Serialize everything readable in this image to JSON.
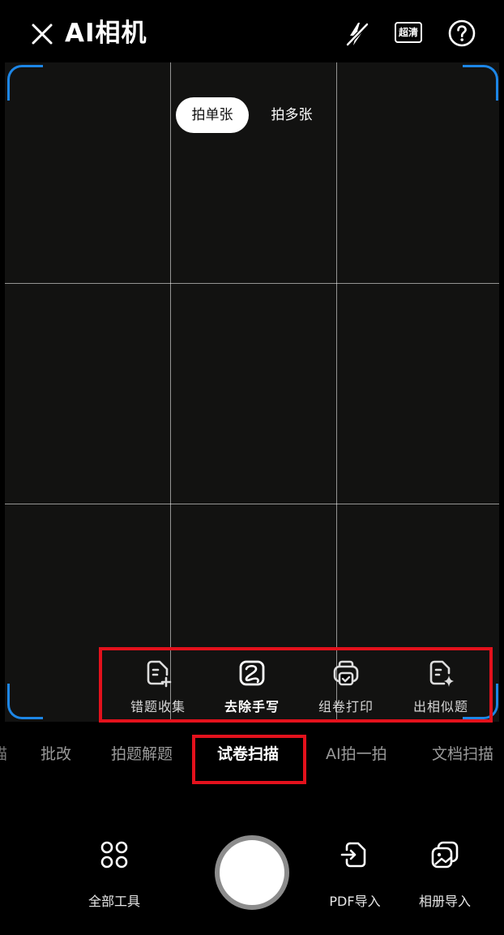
{
  "header": {
    "title": "AI相机",
    "hd_label": "超清",
    "icons": [
      "close-icon",
      "flash-off-icon",
      "help-icon"
    ]
  },
  "shot_mode": {
    "single_label": "拍单张",
    "multi_label": "拍多张",
    "selected": "拍单张"
  },
  "tools": [
    {
      "label": "错题收集",
      "icon": "doc-plus-icon"
    },
    {
      "label": "去除手写",
      "icon": "erase-handwriting-icon"
    },
    {
      "label": "组卷打印",
      "icon": "print-icon"
    },
    {
      "label": "出相似题",
      "icon": "doc-sparkle-icon"
    }
  ],
  "modes": {
    "partial": "描",
    "items": [
      "批改",
      "拍题解题",
      "试卷扫描",
      "AI拍一拍",
      "文档扫描"
    ],
    "selected": "试卷扫描"
  },
  "bottom": {
    "all_tools_label": "全部工具",
    "pdf_import_label": "PDF导入",
    "album_import_label": "相册导入"
  },
  "colors": {
    "accent": "#1d86e6",
    "highlight": "#e3111c",
    "background": "#000000",
    "viewfinder": "#121211"
  }
}
